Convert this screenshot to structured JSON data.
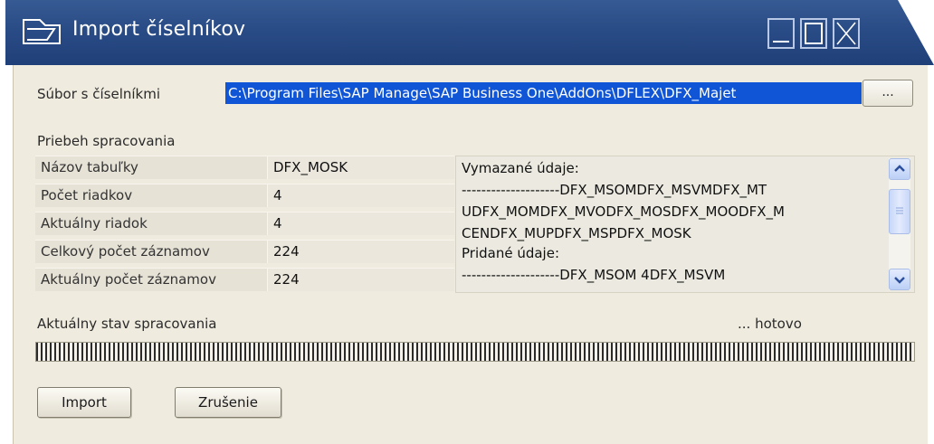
{
  "window": {
    "title": "Import číselníkov",
    "icon": "window-frame-icon"
  },
  "file": {
    "label": "Súbor s číselníkmi",
    "path": "C:\\Program Files\\SAP Manage\\SAP Business One\\AddOns\\DFLEX\\DFX_Majet",
    "browse_label": "..."
  },
  "progress_section": {
    "title": "Priebeh spracovania",
    "rows": [
      {
        "name": "Názov tabuľky",
        "value": "DFX_MOSK"
      },
      {
        "name": "Počet riadkov",
        "value": "4"
      },
      {
        "name": "Aktuálny riadok",
        "value": "4"
      },
      {
        "name": "Celkový počet záznamov",
        "value": "224"
      },
      {
        "name": "Aktuálny počet záznamov",
        "value": "224"
      }
    ]
  },
  "log": {
    "lines": [
      "Vymazané údaje:",
      "--------------------DFX_MSOMDFX_MSVMDFX_MT",
      "UDFX_MOMDFX_MVODFX_MOSDFX_MOODFX_M",
      "CENDFX_MUPDFX_MSPDFX_MOSK",
      "Pridané údaje:",
      "--------------------DFX_MSOM    4DFX_MSVM"
    ]
  },
  "status": {
    "label": "Aktuálny stav spracovania",
    "state": "... hotovo",
    "progress_percent": 100
  },
  "buttons": {
    "import": "Import",
    "cancel": "Zrušenie"
  },
  "colors": {
    "titlebar": "#2a4c86",
    "panel": "#efecdf",
    "selection": "#0f55d6"
  }
}
